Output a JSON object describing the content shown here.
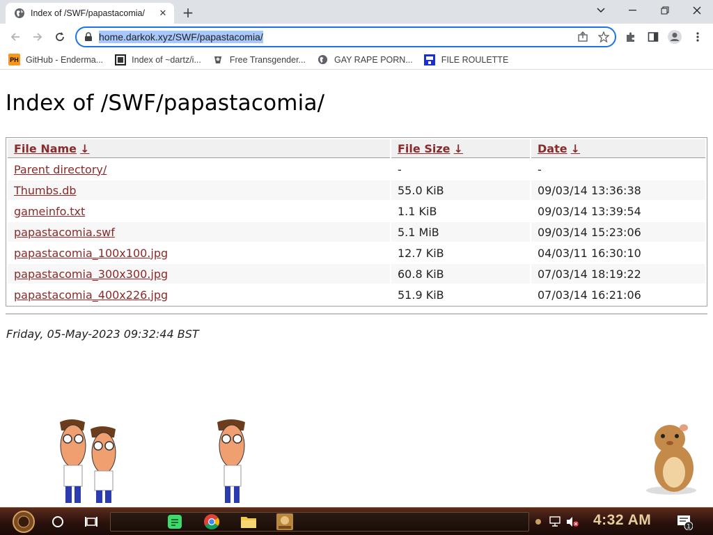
{
  "browser": {
    "tab_title": "Index of /SWF/papastacomia/",
    "url": "home.darkok.xyz/SWF/papastacomia/",
    "bookmarks": [
      {
        "label": "GitHub - Enderma...",
        "icon": "pornhub-ph-icon"
      },
      {
        "label": "Index of ~dartz/i...",
        "icon": "site-favicon-icon"
      },
      {
        "label": "Free Transgender...",
        "icon": "site-favicon-icon"
      },
      {
        "label": "GAY RAPE PORN...",
        "icon": "globe-icon"
      },
      {
        "label": "FILE ROULETTE",
        "icon": "site-favicon-icon"
      }
    ],
    "ph_badge": "PH"
  },
  "page": {
    "heading": "Index of /SWF/papastacomia/",
    "columns": {
      "name": "File Name",
      "size": "File Size",
      "date": "Date",
      "sort_glyph": "↓"
    },
    "rows": [
      {
        "name": "Parent directory/",
        "size": "-",
        "date": "-"
      },
      {
        "name": "Thumbs.db",
        "size": "55.0 KiB",
        "date": "09/03/14 13:36:38"
      },
      {
        "name": "gameinfo.txt",
        "size": "1.1 KiB",
        "date": "09/03/14 13:39:54"
      },
      {
        "name": "papastacomia.swf",
        "size": "5.1 MiB",
        "date": "09/03/14 15:23:06"
      },
      {
        "name": "papastacomia_100x100.jpg",
        "size": "12.7 KiB",
        "date": "04/03/11 16:30:10"
      },
      {
        "name": "papastacomia_300x300.jpg",
        "size": "60.8 KiB",
        "date": "07/03/14 18:19:22"
      },
      {
        "name": "papastacomia_400x226.jpg",
        "size": "51.9 KiB",
        "date": "07/03/14 16:21:06"
      }
    ],
    "footer_date": "Friday, 05-May-2023 09:32:44 BST"
  },
  "taskbar": {
    "clock": "4:32 AM",
    "notification_count": "1"
  },
  "colors": {
    "link": "#8b2a2a",
    "omnibox_focus": "#1a73e8",
    "taskbar": "#2a120c",
    "clock": "#e6cf9a"
  }
}
